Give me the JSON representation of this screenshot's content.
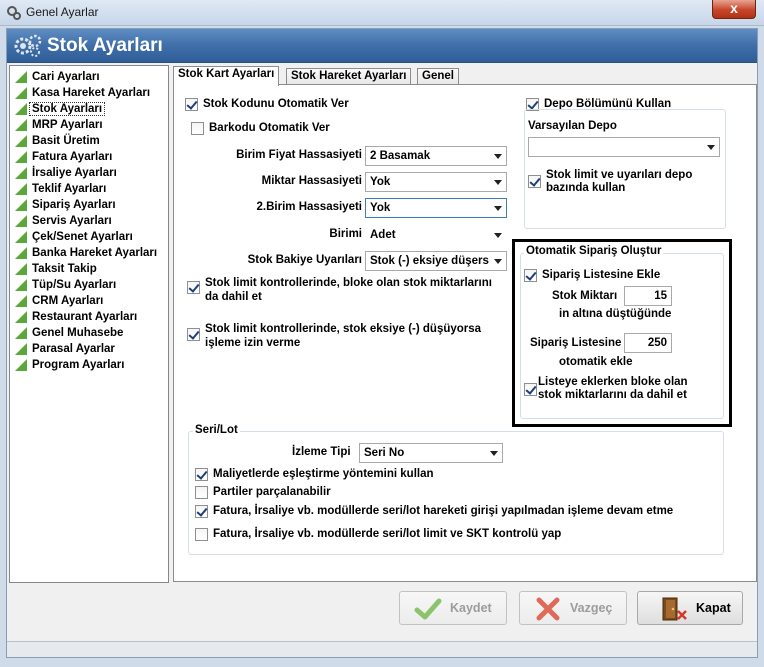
{
  "window": {
    "title": "Genel Ayarlar",
    "close_glyph": "x"
  },
  "header": {
    "title": "Stok Ayarları"
  },
  "sidebar": {
    "items": [
      {
        "label": "Cari Ayarları"
      },
      {
        "label": "Kasa Hareket Ayarları"
      },
      {
        "label": "Stok Ayarları",
        "active": true
      },
      {
        "label": "MRP Ayarları"
      },
      {
        "label": "Basit Üretim"
      },
      {
        "label": "Fatura Ayarları"
      },
      {
        "label": "İrsaliye Ayarları"
      },
      {
        "label": "Teklif Ayarları"
      },
      {
        "label": "Sipariş Ayarları"
      },
      {
        "label": "Servis Ayarları"
      },
      {
        "label": "Çek/Senet Ayarları"
      },
      {
        "label": "Banka Hareket Ayarları"
      },
      {
        "label": "Taksit Takip"
      },
      {
        "label": "Tüp/Su Ayarları"
      },
      {
        "label": "CRM Ayarları"
      },
      {
        "label": "Restaurant Ayarları"
      },
      {
        "label": "Genel Muhasebe"
      },
      {
        "label": "Parasal Ayarlar"
      },
      {
        "label": "Program Ayarları"
      }
    ]
  },
  "tabs": [
    {
      "label": "Stok Kart Ayarları",
      "active": true
    },
    {
      "label": "Stok Hareket Ayarları"
    },
    {
      "label": "Genel"
    }
  ],
  "stok_kart": {
    "auto_code": {
      "label": "Stok Kodunu Otomatik Ver",
      "checked": true
    },
    "auto_barcode": {
      "label": "Barkodu Otomatik Ver",
      "checked": false
    },
    "unit_price_precision": {
      "label": "Birim Fiyat Hassasiyeti",
      "value": "2 Basamak"
    },
    "quantity_precision": {
      "label": "Miktar Hassasiyeti",
      "value": "Yok"
    },
    "second_unit_precision": {
      "label": "2.Birim Hassasiyeti",
      "value": "Yok"
    },
    "unit": {
      "label": "Birimi",
      "value": "Adet"
    },
    "stock_balance_warnings": {
      "label": "Stok Bakiye Uyarıları",
      "value": "Stok (-) eksiye düşers"
    },
    "include_blocked": {
      "label_line1": "Stok limit kontrollerinde, bloke olan stok miktarlarını",
      "label_line2": "da dahil et",
      "checked": true
    },
    "allow_negative": {
      "label_line1": "Stok limit kontrollerinde, stok eksiye (-) düşüyorsa",
      "label_line2": "işleme izin verme",
      "checked": true
    },
    "use_depot_section": {
      "label": "Depo Bölümünü Kullan",
      "checked": true
    },
    "default_depot": {
      "label": "Varsayılan Depo",
      "value": ""
    },
    "depot_based_limits": {
      "label_line1": "Stok limit ve uyarıları depo",
      "label_line2": "bazında kullan",
      "checked": true
    },
    "auto_order": {
      "title": "Otomatik Sipariş Oluştur",
      "add_to_list": {
        "label": "Sipariş Listesine Ekle",
        "checked": true
      },
      "stock_qty_label": "Stok Miktarı",
      "stock_qty_value": "15",
      "below_label": "in altına düştüğünde",
      "order_list_label": "Sipariş Listesine",
      "order_list_value": "250",
      "auto_add_label": "otomatik ekle",
      "include_blocked": {
        "label_line1": "Listeye eklerken bloke olan",
        "label_line2": "stok miktarlarını da dahil et",
        "checked": true
      }
    },
    "serial_lot": {
      "title": "Seri/Lot",
      "tracking_type": {
        "label": "İzleme Tipi",
        "value": "Seri No"
      },
      "cost_matching": {
        "label": "Maliyetlerde eşleştirme yöntemini kullan",
        "checked": true
      },
      "split_batches": {
        "label": "Partiler parçalanabilir",
        "checked": false
      },
      "continue_without_entry": {
        "label": "Fatura, İrsaliye vb. modüllerde seri/lot hareketi girişi yapılmadan işleme devam etme",
        "checked": true
      },
      "limit_skt_control": {
        "label": "Fatura, İrsaliye vb. modüllerde seri/lot limit ve SKT kontrolü yap",
        "checked": false
      }
    }
  },
  "buttons": {
    "save": "Kaydet",
    "cancel": "Vazgeç",
    "close": "Kapat"
  },
  "colors": {
    "header_blue": "#3f6ea8",
    "list_triangle_green": "#5aa83b"
  }
}
